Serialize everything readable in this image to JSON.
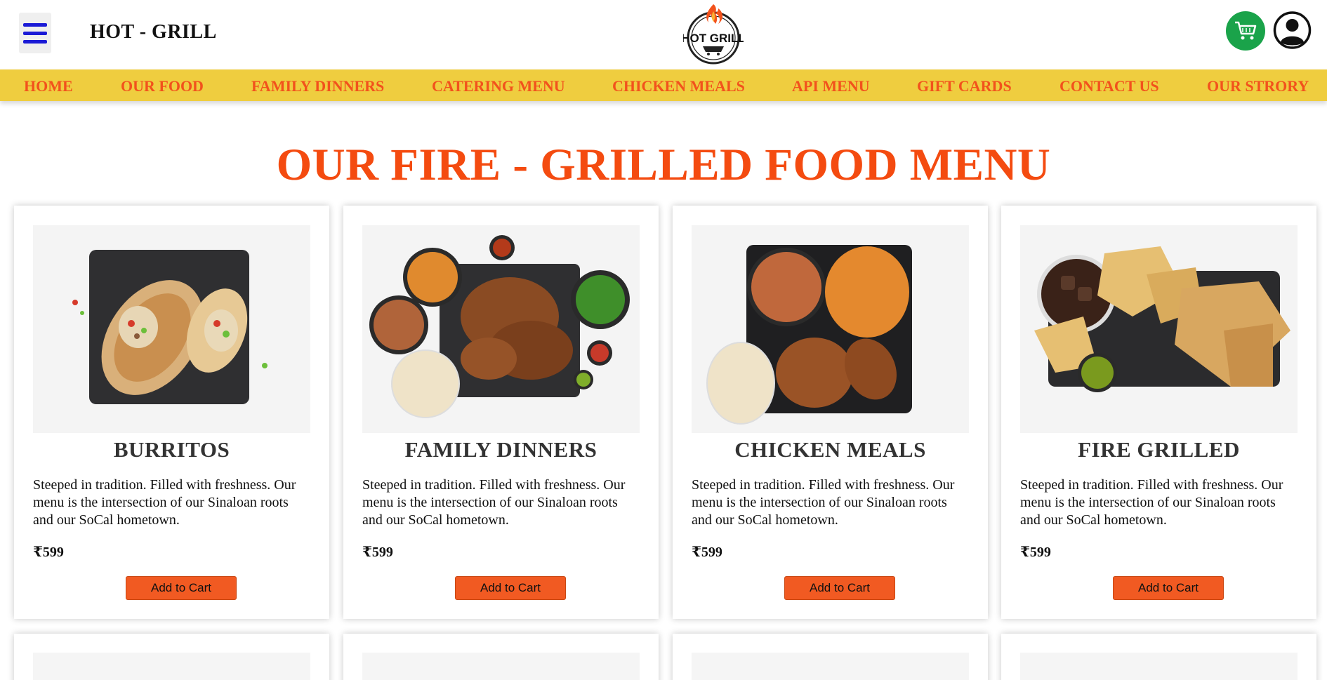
{
  "header": {
    "brand": "HOT - GRILL",
    "logo_text": "HOT GRILL",
    "menu_icon": "hamburger-icon",
    "cart_icon": "shopping-cart-icon",
    "user_icon": "user-account-icon"
  },
  "nav": {
    "items": [
      {
        "label": "HOME"
      },
      {
        "label": "OUR FOOD"
      },
      {
        "label": "FAMILY DINNERS"
      },
      {
        "label": "CATERING MENU"
      },
      {
        "label": "CHICKEN MEALS"
      },
      {
        "label": "API MENU"
      },
      {
        "label": "GIFT CARDS"
      },
      {
        "label": "CONTACT US"
      },
      {
        "label": "OUR STRORY"
      }
    ]
  },
  "main": {
    "title": "OUR FIRE - GRILLED FOOD MENU",
    "cards": [
      {
        "title": "BURRITOS",
        "description": "Steeped in tradition. Filled with freshness. Our menu is the intersection of our Sinaloan roots and our SoCal hometown.",
        "price": "₹599",
        "button": "Add to Cart",
        "image": "burrito-photo"
      },
      {
        "title": "FAMILY DINNERS",
        "description": "Steeped in tradition. Filled with freshness. Our menu is the intersection of our Sinaloan roots and our SoCal hometown.",
        "price": "₹599",
        "button": "Add to Cart",
        "image": "family-dinner-photo"
      },
      {
        "title": "CHICKEN MEALS",
        "description": "Steeped in tradition. Filled with freshness. Our menu is the intersection of our Sinaloan roots and our SoCal hometown.",
        "price": "₹599",
        "button": "Add to Cart",
        "image": "chicken-meal-photo"
      },
      {
        "title": "FIRE GRILLED",
        "description": "Steeped in tradition. Filled with freshness. Our menu is the intersection of our Sinaloan roots and our SoCal hometown.",
        "price": "₹599",
        "button": "Add to Cart",
        "image": "fire-grilled-photo"
      }
    ]
  },
  "colors": {
    "accent": "#f44b10",
    "nav_bg": "#efcd3f",
    "button": "#f15a22",
    "cart": "#1aa34a"
  }
}
